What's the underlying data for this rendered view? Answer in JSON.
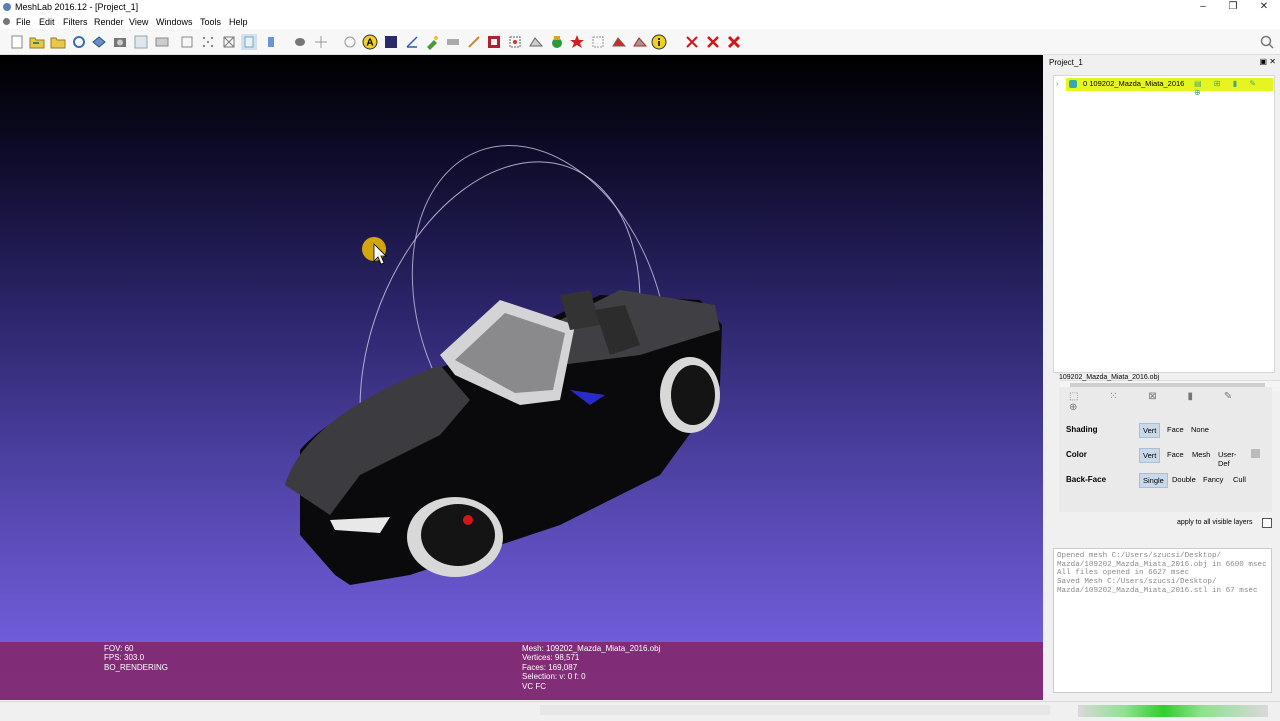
{
  "window": {
    "title": "MeshLab 2016.12 - [Project_1]",
    "minimize": "‒",
    "maximize": "❐",
    "close": "✕"
  },
  "menu": [
    "File",
    "Edit",
    "Filters",
    "Render",
    "View",
    "Windows",
    "Tools",
    "Help"
  ],
  "toolbar": {
    "icons": [
      "new-project-icon",
      "open-project-icon",
      "import-mesh-icon",
      "reload-icon",
      "save-snapshot-icon",
      "screenshot-icon",
      "layer-stack-icon",
      "layers-icon",
      "bounding-box-icon",
      "points-icon",
      "wireframe-icon",
      "hidden-lines-icon",
      "flat-shading-icon",
      "smooth-shading-icon",
      "light-icon",
      "trackball-icon",
      "annotation-icon",
      "texture-icon",
      "measure-icon",
      "pick-icon",
      "paint-icon",
      "color-icon",
      "select-faces-icon",
      "select-vertices-icon",
      "select-connected-icon",
      "z-painting-icon",
      "align-icon",
      "manipulator-icon",
      "move-icon",
      "rotate-icon",
      "info-icon",
      "delete-faces-icon",
      "delete-vertices-icon",
      "delete-all-icon"
    ],
    "search_icon": "search-icon"
  },
  "viewport": {
    "background_top": "#000000",
    "background_bottom": "#7a66e6",
    "info": {
      "left": [
        "FOV: 60",
        "FPS:   303.0",
        "BO_RENDERING"
      ],
      "right": [
        "Mesh: 109202_Mazda_Miata_2016.obj",
        "Vertices: 98,571",
        "Faces: 169,087",
        "Selection: v: 0 f: 0",
        "VC FC"
      ]
    }
  },
  "side_panel": {
    "title": "Project_1",
    "buttons": "▣ ✕",
    "layer": {
      "index_name": "0  109202_Mazda_Miata_2016",
      "expander": "›",
      "action_icons": "▤ ⊞ ▮ ✎ ⊕"
    },
    "mesh_file": "109202_Mazda_Miata_2016.obj",
    "property_icons": "⬚ ⁙ ⊠ ▮ ✎ ⊕",
    "shading": {
      "label": "Shading",
      "options": [
        "Vert",
        "Face",
        "None"
      ],
      "selected": "Vert"
    },
    "color": {
      "label": "Color",
      "options": [
        "Vert",
        "Face",
        "Mesh",
        "User-Def"
      ],
      "selected": "Vert",
      "swatch": "#bbbbbb"
    },
    "backface": {
      "label": "Back-Face",
      "options": [
        "Single",
        "Double",
        "Fancy",
        "Cull"
      ],
      "selected": "Single"
    },
    "apply_label": "apply to all visible layers",
    "log": [
      "Opened mesh C:/Users/szucsi/Desktop/ Mazda/109202_Mazda_Miata_2016.obj in 6600 msec",
      "All files opened in 6627 msec",
      "Saved Mesh C:/Users/szucsi/Desktop/ Mazda/109202_Mazda_Miata_2016.stl in 67 msec"
    ]
  }
}
